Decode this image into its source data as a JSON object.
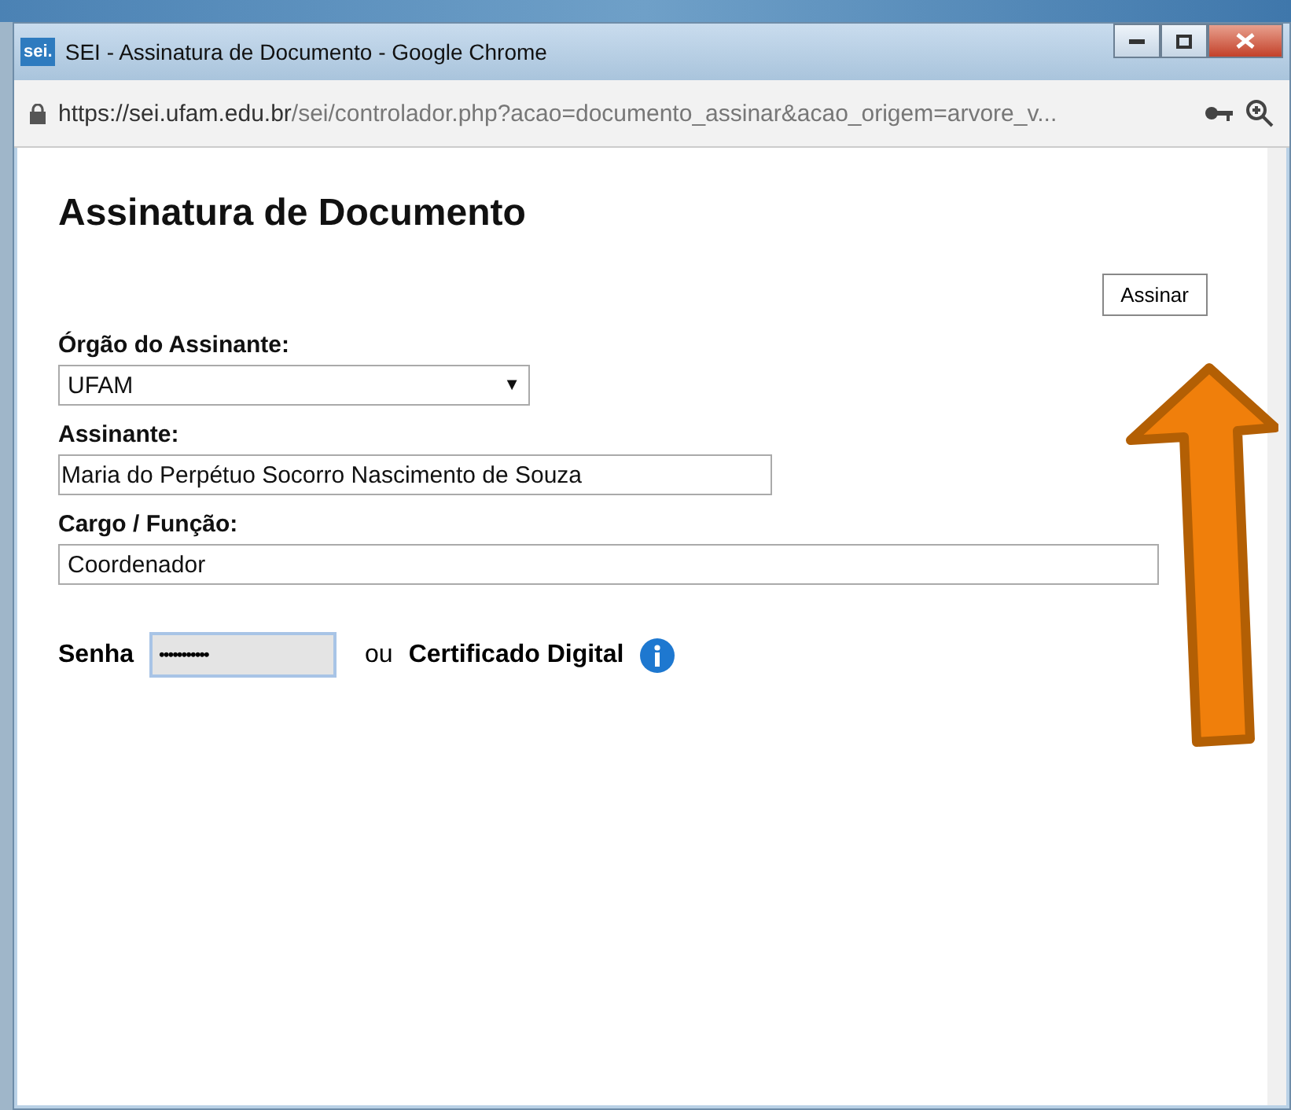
{
  "window": {
    "title": "SEI - Assinatura de Documento - Google Chrome",
    "app_logo": "sei."
  },
  "address_bar": {
    "host": "https://sei.ufam.edu.br",
    "path": "/sei/controlador.php?acao=documento_assinar&acao_origem=arvore_v..."
  },
  "page": {
    "heading": "Assinatura de Documento",
    "sign_button": "Assinar",
    "fields": [
      {
        "kind": "select",
        "label": "Órgão do Assinante:",
        "value": "UFAM",
        "caret": "▼"
      },
      {
        "kind": "text",
        "label": "Assinante:",
        "value": "Maria do Perpétuo Socorro Nascimento de Souza"
      },
      {
        "kind": "wide",
        "label": "Cargo / Função:",
        "value": "Coordenador"
      }
    ],
    "password": {
      "label": "Senha",
      "value": "•••••••••••",
      "separator": "ou",
      "certificate": "Certificado Digital"
    }
  }
}
